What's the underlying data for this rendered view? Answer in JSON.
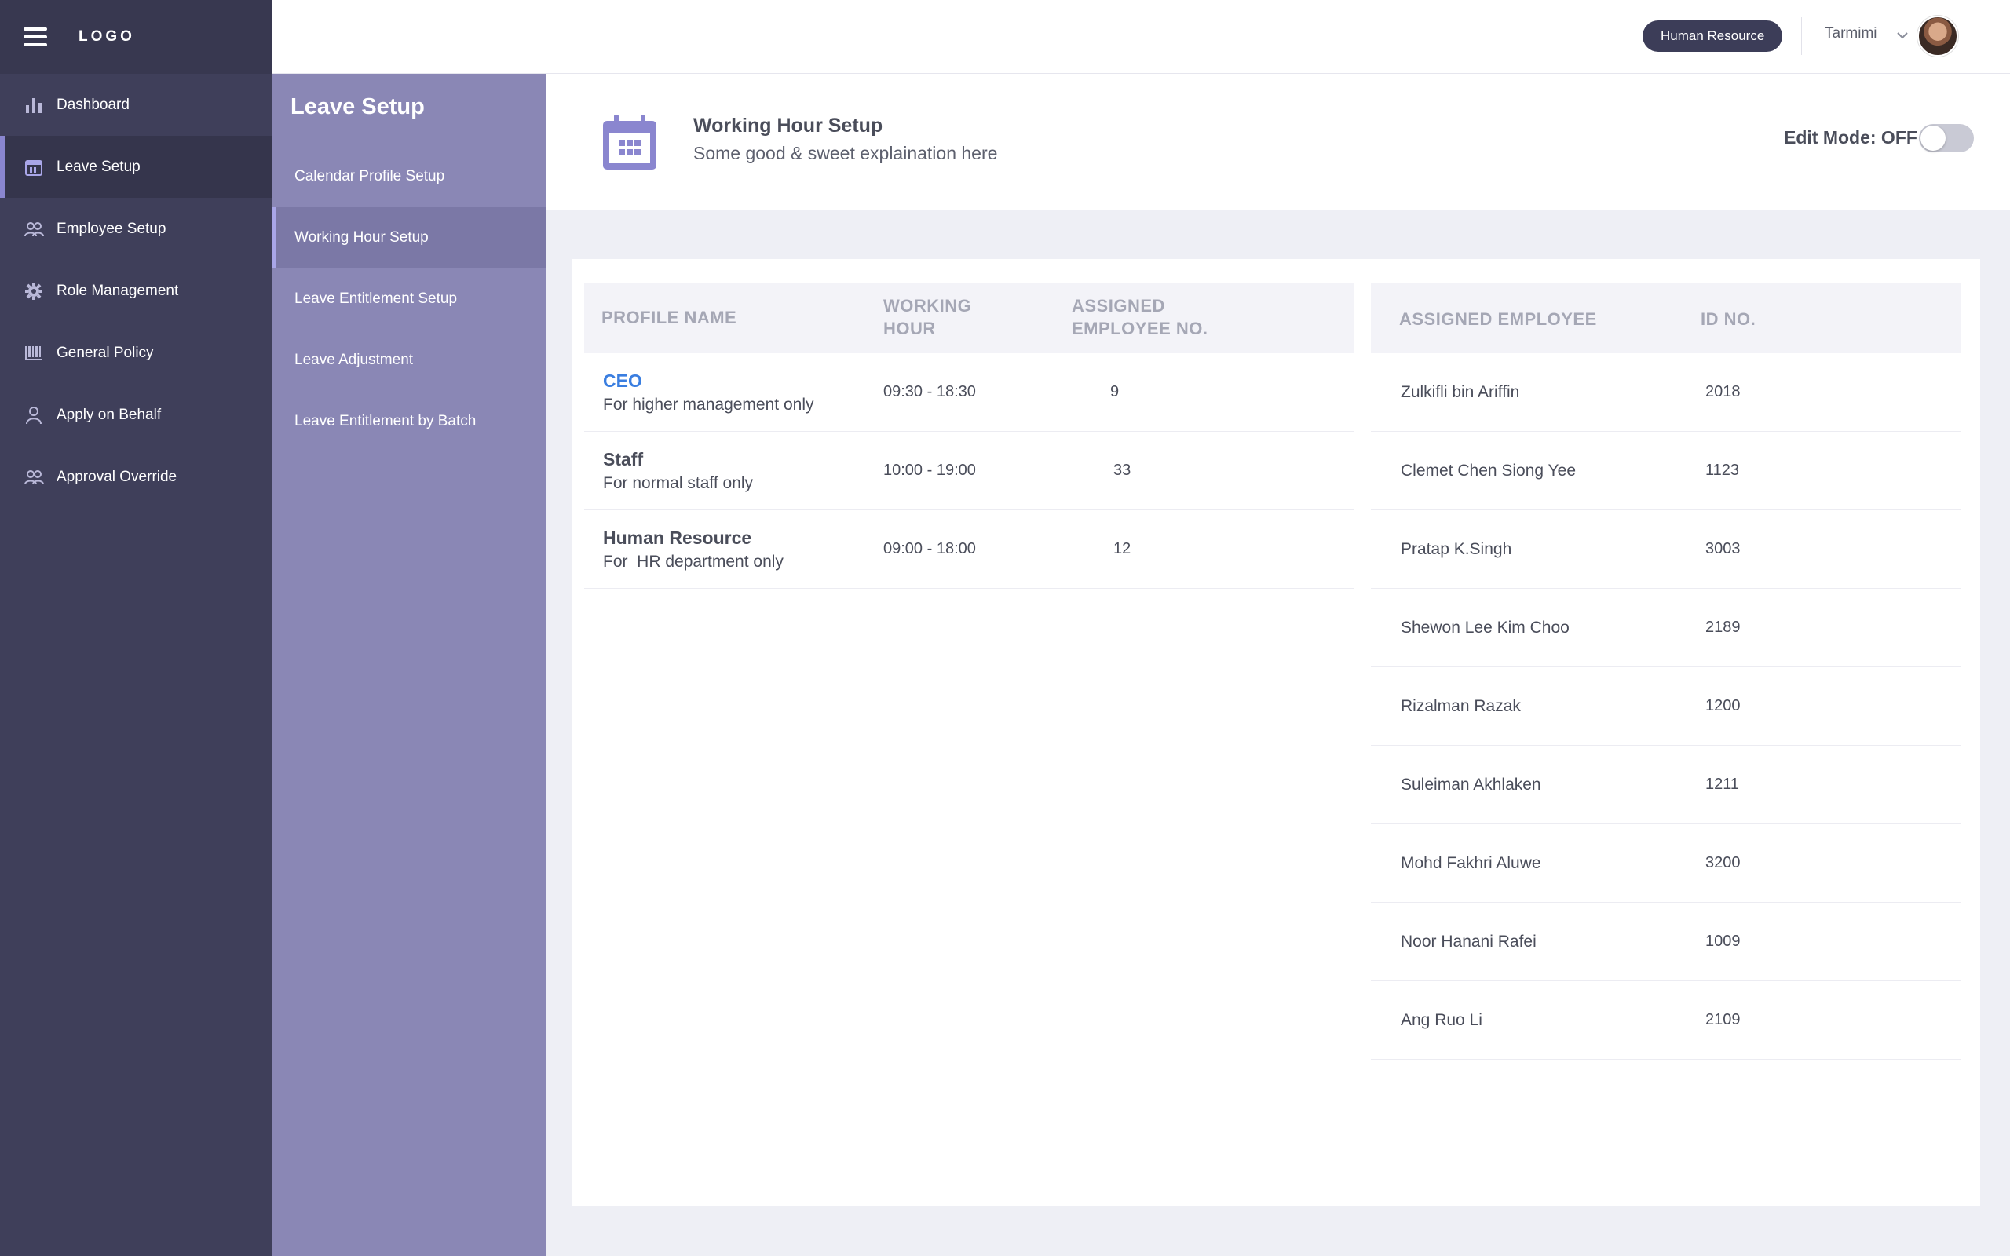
{
  "app": {
    "logo_text": "LOGO"
  },
  "sidebar": {
    "items": [
      {
        "label": "Dashboard",
        "icon": "bar-chart-icon"
      },
      {
        "label": "Leave Setup",
        "icon": "calendar-icon"
      },
      {
        "label": "Employee Setup",
        "icon": "people-icon"
      },
      {
        "label": "Role Management",
        "icon": "gear-icon"
      },
      {
        "label": "General Policy",
        "icon": "barcode-icon"
      },
      {
        "label": "Apply on Behalf",
        "icon": "person-icon"
      },
      {
        "label": "Approval Override",
        "icon": "people-icon"
      }
    ],
    "active_index": 1
  },
  "submenu": {
    "title": "Leave Setup",
    "items": [
      {
        "label": "Calendar Profile Setup"
      },
      {
        "label": "Working Hour Setup"
      },
      {
        "label": "Leave Entitlement Setup"
      },
      {
        "label": "Leave Adjustment"
      },
      {
        "label": "Leave Entitlement by Batch"
      }
    ],
    "active_index": 1
  },
  "topbar": {
    "role_badge": "Human Resource",
    "username": "Tarmimi"
  },
  "header": {
    "title": "Working Hour Setup",
    "subtitle": "Some good & sweet explaination here",
    "edit_mode_label": "Edit Mode: OFF",
    "edit_mode_on": false
  },
  "profiles": {
    "columns": {
      "name": "PROFILE NAME",
      "hour_line1": "WORKING",
      "hour_line2": "HOUR",
      "count_line1": "ASSIGNED",
      "count_line2": "EMPLOYEE NO."
    },
    "rows": [
      {
        "name": "CEO",
        "description": "For higher management only",
        "hours": "09:30 - 18:30",
        "count": "9"
      },
      {
        "name": "Staff",
        "description": "For normal staff only",
        "hours": "10:00 - 19:00",
        "count": "33"
      },
      {
        "name": "Human Resource",
        "description": "For  HR department only",
        "hours": "09:00 - 18:00",
        "count": "12"
      }
    ]
  },
  "employees": {
    "columns": {
      "name": "ASSIGNED EMPLOYEE",
      "id": "ID NO."
    },
    "rows": [
      {
        "name": "Zulkifli bin Ariffin",
        "id": "2018"
      },
      {
        "name": "Clemet Chen Siong Yee",
        "id": "1123"
      },
      {
        "name": "Pratap K.Singh",
        "id": "3003"
      },
      {
        "name": "Shewon Lee Kim Choo",
        "id": "2189"
      },
      {
        "name": "Rizalman Razak",
        "id": "1200"
      },
      {
        "name": "Suleiman Akhlaken",
        "id": "1211"
      },
      {
        "name": "Mohd Fakhri Aluwe",
        "id": "3200"
      },
      {
        "name": "Noor Hanani Rafei",
        "id": "1009"
      },
      {
        "name": "Ang Ruo Li",
        "id": "2109"
      }
    ]
  },
  "colors": {
    "sidebar_bg": "#3f3f5a",
    "submenu_bg": "#8a87b5",
    "accent": "#8a86cf",
    "link": "#3a7ee0",
    "badge_bg": "#3c3d58"
  }
}
